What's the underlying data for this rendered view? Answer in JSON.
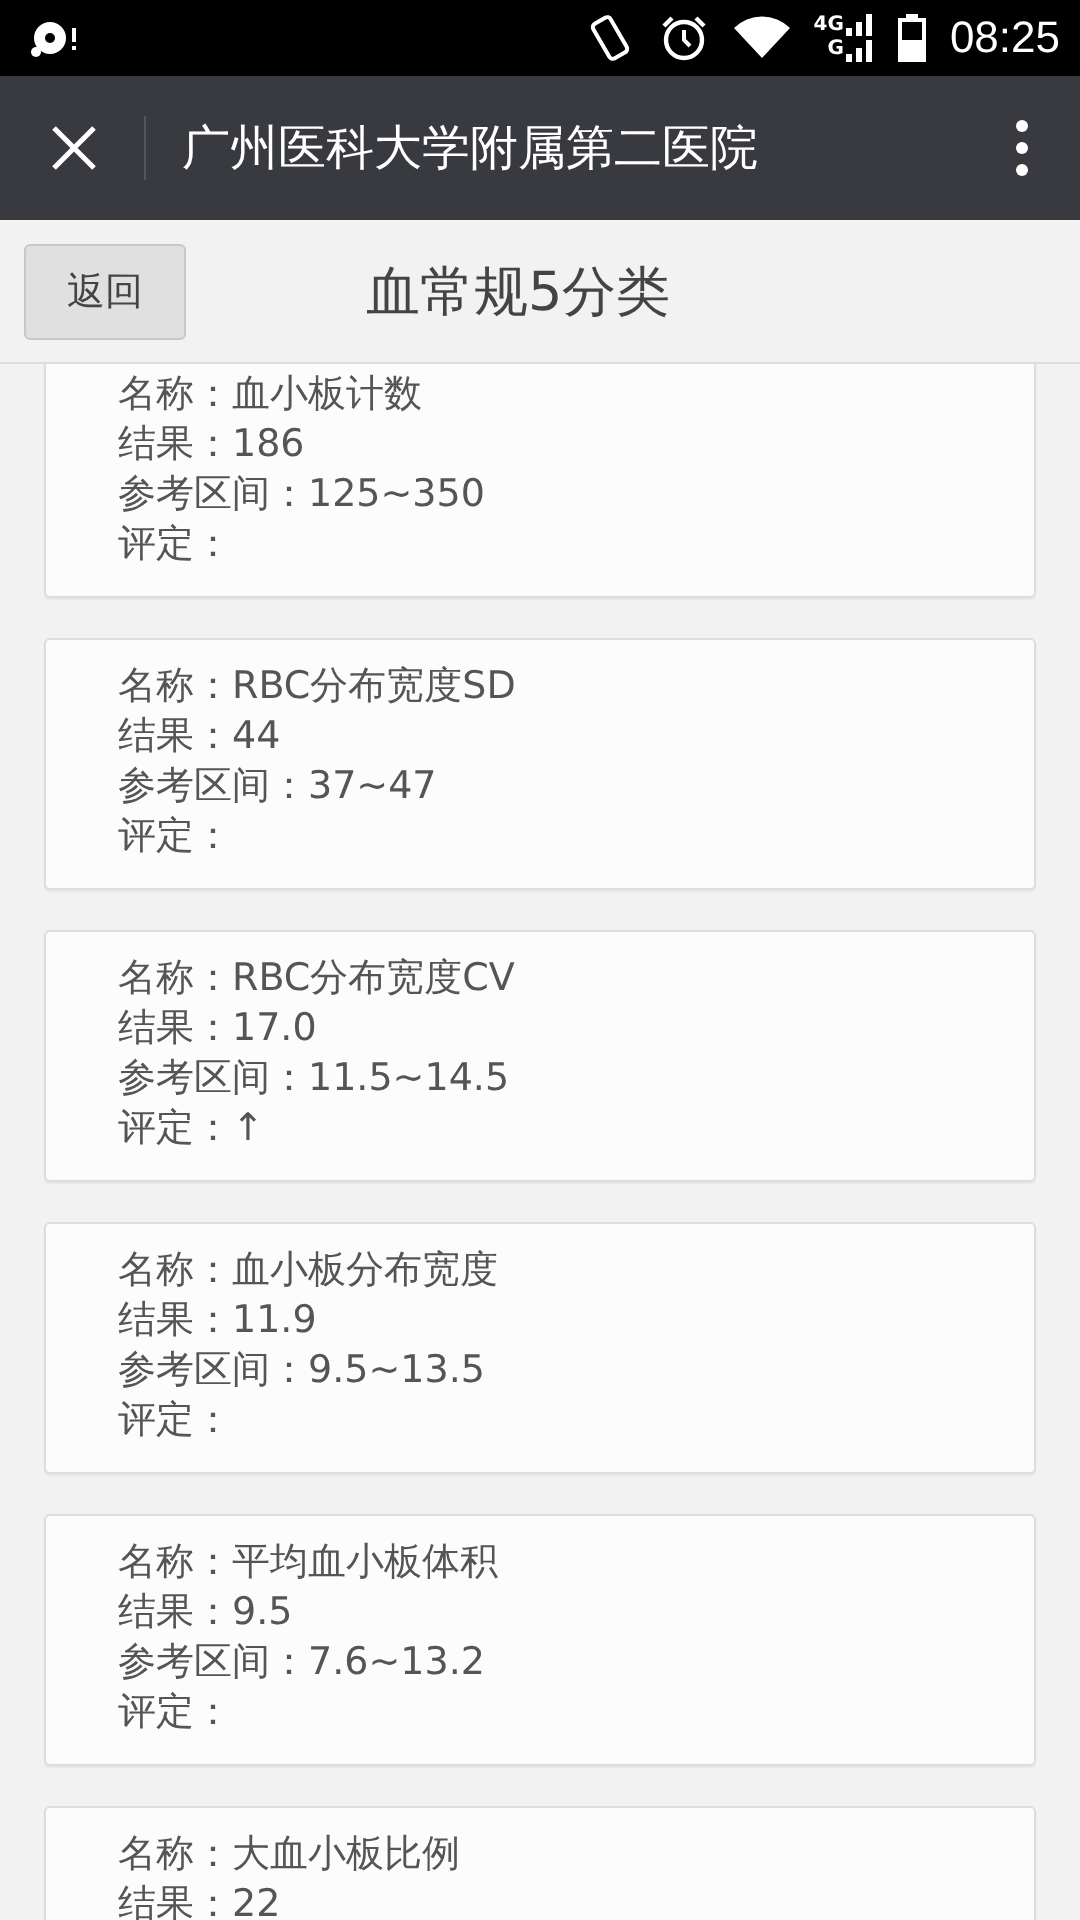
{
  "status_bar": {
    "time": "08:25",
    "network_labels": [
      "4G",
      "G"
    ]
  },
  "app_bar": {
    "title": "广州医科大学附属第二医院"
  },
  "header": {
    "back_button": "返回",
    "title": "血常规5分类"
  },
  "cards": [
    {
      "lines": [
        "名称：血小板计数",
        "结果：186",
        "参考区间：125~350",
        "评定："
      ]
    },
    {
      "lines": [
        "名称：RBC分布宽度SD",
        "结果：44",
        "参考区间：37~47",
        "评定："
      ]
    },
    {
      "lines": [
        "名称：RBC分布宽度CV",
        "结果：17.0",
        "参考区间：11.5~14.5",
        "评定：↑"
      ]
    },
    {
      "lines": [
        "名称：血小板分布宽度",
        "结果：11.9",
        "参考区间：9.5~13.5",
        "评定："
      ]
    },
    {
      "lines": [
        "名称：平均血小板体积",
        "结果：9.5",
        "参考区间：7.6~13.2",
        "评定："
      ]
    },
    {
      "lines": [
        "名称：大血小板比例",
        "结果：22"
      ]
    }
  ]
}
